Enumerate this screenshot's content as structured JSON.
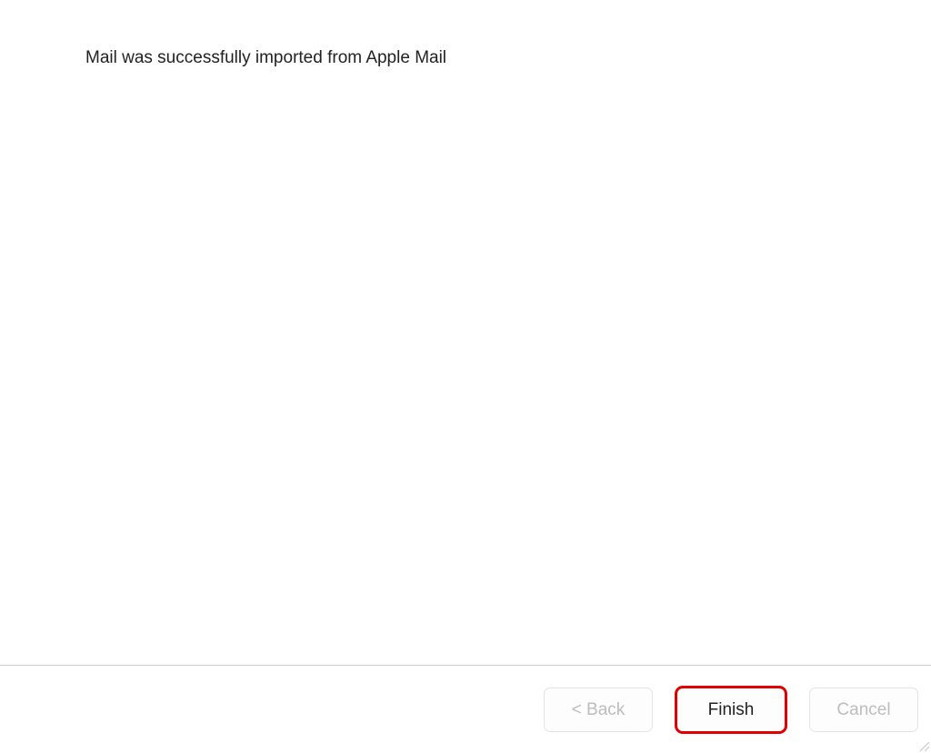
{
  "main": {
    "status_message": "Mail was successfully imported from Apple Mail"
  },
  "footer": {
    "back_label": "< Back",
    "finish_label": "Finish",
    "cancel_label": "Cancel"
  }
}
